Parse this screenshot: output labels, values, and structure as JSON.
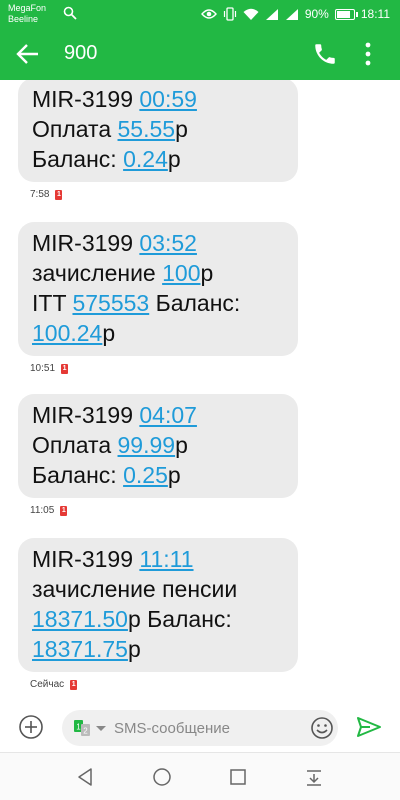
{
  "status_bar": {
    "carrier1": "MegaFon",
    "carrier2": "Beeline",
    "battery": "90%",
    "battery_level": 0.9,
    "time": "18:11",
    "icons": [
      "search-icon",
      "eye-icon",
      "vibrate-icon",
      "wifi-icon",
      "signal-icon",
      "battery-icon"
    ]
  },
  "app_bar": {
    "title": "900",
    "icons": [
      "back-arrow-icon",
      "phone-icon",
      "more-vert-icon"
    ]
  },
  "messages": [
    {
      "lines": [
        [
          {
            "t": "MIR-3199 "
          },
          {
            "t": "00:59",
            "link": true
          }
        ],
        [
          {
            "t": "Оплата "
          },
          {
            "t": "55.55",
            "link": true
          },
          {
            "t": "р"
          }
        ],
        [
          {
            "t": "Баланс: "
          },
          {
            "t": "0.24",
            "link": true
          },
          {
            "t": "р"
          }
        ]
      ],
      "time": "7:58",
      "sim": "1"
    },
    {
      "lines": [
        [
          {
            "t": "MIR-3199 "
          },
          {
            "t": "03:52",
            "link": true
          }
        ],
        [
          {
            "t": "зачисление "
          },
          {
            "t": "100",
            "link": true
          },
          {
            "t": "р"
          }
        ],
        [
          {
            "t": "ITT "
          },
          {
            "t": "575553",
            "link": true
          },
          {
            "t": " Баланс:"
          }
        ],
        [
          {
            "t": "100.24",
            "link": true
          },
          {
            "t": "р"
          }
        ]
      ],
      "time": "10:51",
      "sim": "1"
    },
    {
      "lines": [
        [
          {
            "t": "MIR-3199 "
          },
          {
            "t": "04:07",
            "link": true
          }
        ],
        [
          {
            "t": "Оплата "
          },
          {
            "t": "99.99",
            "link": true
          },
          {
            "t": "р"
          }
        ],
        [
          {
            "t": "Баланс: "
          },
          {
            "t": "0.25",
            "link": true
          },
          {
            "t": "р"
          }
        ]
      ],
      "time": "11:05",
      "sim": "1"
    },
    {
      "lines": [
        [
          {
            "t": "MIR-3199 "
          },
          {
            "t": "11:11",
            "link": true
          }
        ],
        [
          {
            "t": "зачисление пенсии"
          }
        ],
        [
          {
            "t": "18371.50",
            "link": true
          },
          {
            "t": "р Баланс:"
          }
        ],
        [
          {
            "t": "18371.75",
            "link": true
          },
          {
            "t": "р"
          }
        ]
      ],
      "time": "Сейчас",
      "sim": "1"
    }
  ],
  "compose": {
    "placeholder": "SMS-сообщение",
    "sim_labels": [
      "1",
      "2"
    ],
    "icons": [
      "add-circle-icon",
      "sim-select-icon",
      "emoji-icon",
      "send-icon"
    ]
  },
  "nav_bar": {
    "icons": [
      "nav-back-icon",
      "nav-home-icon",
      "nav-recent-icon",
      "nav-notifications-icon"
    ]
  },
  "colors": {
    "primary": "#22b844",
    "link": "#1f9bd9",
    "bubble": "#ebebeb",
    "sim_badge": "#e53935"
  }
}
